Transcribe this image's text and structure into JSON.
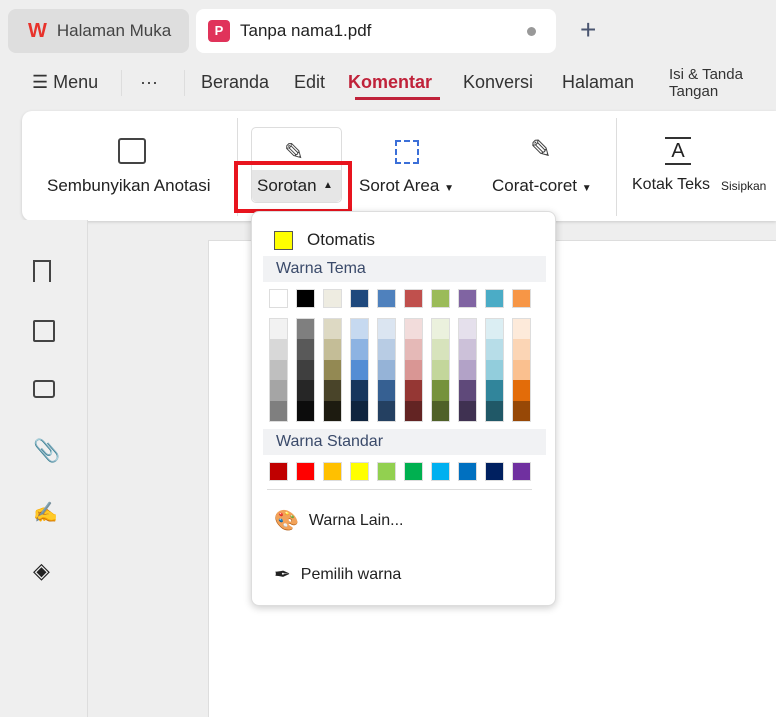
{
  "tabs": [
    {
      "label": "Halaman Muka",
      "icon": "wps-logo-icon"
    },
    {
      "label": "Tanpa nama1.pdf",
      "icon": "pdf-icon",
      "unsaved": true
    }
  ],
  "new_tab": "+",
  "menu": {
    "menu_label": "Menu",
    "more": "···",
    "items": [
      "Beranda",
      "Edit",
      "Komentar",
      "Konversi",
      "Halaman",
      "Isi & Tanda Tangan"
    ],
    "active": "Komentar",
    "accent": "#c0223a"
  },
  "toolbar": {
    "hide": "Sembunyikan Anotasi",
    "highlight": "Sorotan",
    "area": "Sorot Area",
    "draw": "Corat-coret",
    "textbox": "Kotak Teks",
    "insert": "Sisipkan"
  },
  "popup": {
    "auto": "Otomatis",
    "auto_color": "#ffff00",
    "theme_title": "Warna Tema",
    "theme_top": [
      "#ffffff",
      "#000000",
      "#eeece1",
      "#1f497d",
      "#4f81bd",
      "#c0504d",
      "#9bbb59",
      "#8064a2",
      "#4bacc6",
      "#f79646"
    ],
    "theme_shades": [
      [
        "#f2f2f2",
        "#d8d8d8",
        "#bfbfbf",
        "#a5a5a5",
        "#7f7f7f"
      ],
      [
        "#7f7f7f",
        "#595959",
        "#3f3f3f",
        "#262626",
        "#0c0c0c"
      ],
      [
        "#ddd9c3",
        "#c4bd97",
        "#938953",
        "#494429",
        "#1d1b10"
      ],
      [
        "#c6d9f0",
        "#8db3e2",
        "#548dd4",
        "#17365d",
        "#0f243e"
      ],
      [
        "#dbe5f1",
        "#b8cce4",
        "#95b3d7",
        "#366092",
        "#244061"
      ],
      [
        "#f2dcdb",
        "#e5b9b7",
        "#d99694",
        "#953734",
        "#632423"
      ],
      [
        "#ebf1dd",
        "#d7e3bc",
        "#c3d69b",
        "#76923c",
        "#4f6128"
      ],
      [
        "#e5e0ec",
        "#ccc1d9",
        "#b2a2c7",
        "#5f497a",
        "#3f3151"
      ],
      [
        "#dbeef3",
        "#b7dde8",
        "#92cddc",
        "#31859b",
        "#205867"
      ],
      [
        "#fdeada",
        "#fbd5b5",
        "#fac08f",
        "#e36c09",
        "#974806"
      ]
    ],
    "standard_title": "Warna Standar",
    "standard": [
      "#c00000",
      "#ff0000",
      "#ffc000",
      "#ffff00",
      "#92d050",
      "#00b050",
      "#00b0f0",
      "#0070c0",
      "#002060",
      "#7030a0"
    ],
    "more_colors": "Warna Lain...",
    "picker": "Pemilih warna"
  }
}
